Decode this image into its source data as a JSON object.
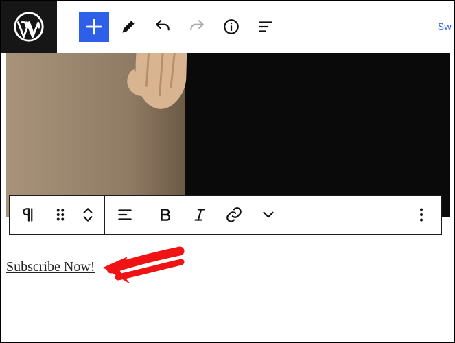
{
  "topbar": {
    "switch_label": "Sw"
  },
  "content": {
    "link_text": "Subscribe Now!"
  },
  "icons": {
    "wp": "wordpress-logo",
    "add": "plus-icon",
    "edit": "pencil-icon",
    "undo": "undo-icon",
    "redo": "redo-icon",
    "info": "info-icon",
    "outline": "list-outline-icon",
    "paragraph": "pilcrow-icon",
    "drag": "drag-handle-icon",
    "movers": "up-down-chevron-icon",
    "align": "align-left-icon",
    "bold": "bold-icon",
    "italic": "italic-icon",
    "link": "link-icon",
    "chevdown": "chevron-down-icon",
    "more": "more-vertical-icon"
  }
}
